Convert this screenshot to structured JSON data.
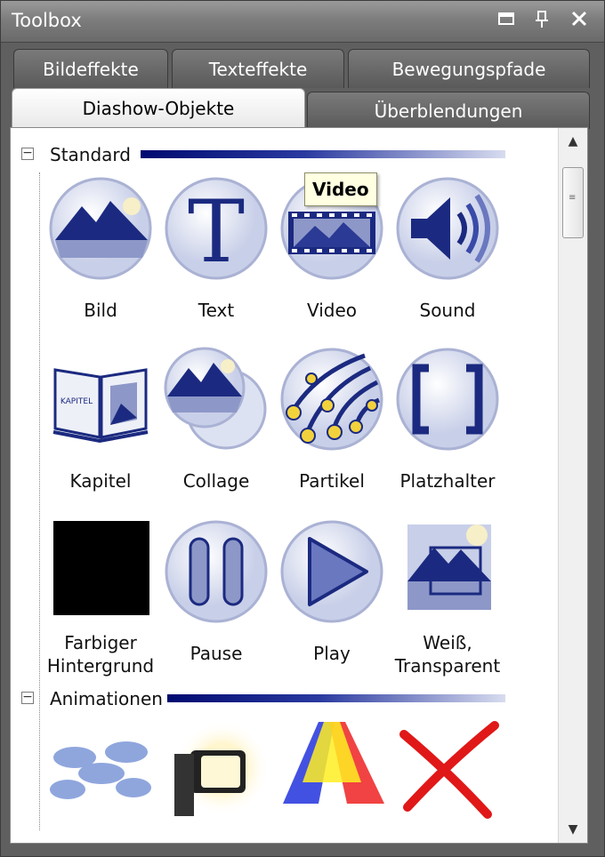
{
  "window": {
    "title": "Toolbox"
  },
  "tabs_row1": [
    "Bildeffekte",
    "Texteffekte",
    "Bewegungspfade"
  ],
  "tabs_row2": [
    "Diashow-Objekte",
    "Überblendungen"
  ],
  "active_tab": "Diashow-Objekte",
  "groups": {
    "standard": {
      "label": "Standard"
    },
    "animationen": {
      "label": "Animationen"
    }
  },
  "tooltip": "Video",
  "items": {
    "bild": "Bild",
    "text": "Text",
    "text_glyph": "T",
    "video": "Video",
    "sound": "Sound",
    "kapitel": "Kapitel",
    "kapitel_book_word": "KAPITEL",
    "collage": "Collage",
    "partikel": "Partikel",
    "platzhalter": "Platzhalter",
    "farbiger_line1": "Farbiger",
    "farbiger_line2": "Hintergrund",
    "pause": "Pause",
    "play": "Play",
    "weiss_line1": "Weiß,",
    "weiss_line2": "Transparent"
  },
  "colors": {
    "accent": "#1b2a80",
    "title_bar": "#7d7d7d",
    "tab_inactive": "#5a5a5a"
  }
}
